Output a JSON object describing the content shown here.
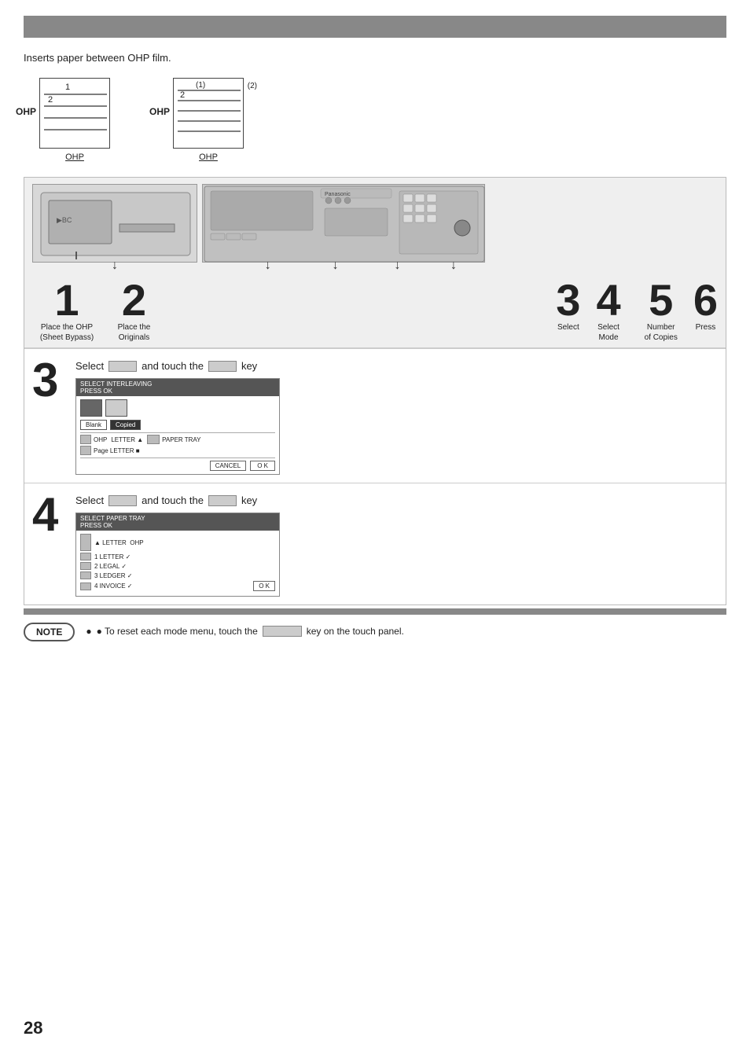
{
  "page": {
    "top_bar_bg": "#888888",
    "intro_text": "Inserts paper between OHP film.",
    "ohp_diagrams": {
      "box1": {
        "side_label": "OHP",
        "bottom_label": "OHP",
        "number1": "1",
        "number2": "2"
      },
      "box2": {
        "side_label": "OHP",
        "bottom_label": "OHP",
        "number1": "(1)",
        "number2": "2",
        "extra": "(2)"
      }
    },
    "step_numbers": [
      {
        "num": "1",
        "label": "Place the OHP\n(Sheet Bypass)"
      },
      {
        "num": "2",
        "label": "Place the\nOriginals"
      },
      {
        "num": "3",
        "label": "Select"
      },
      {
        "num": "4",
        "label": "Select\nMode"
      },
      {
        "num": "5",
        "label": "Number\nof Copies"
      },
      {
        "num": "6",
        "label": "Press"
      }
    ],
    "step3": {
      "big_num": "3",
      "title_prefix": "Select",
      "title_middle": "and touch the",
      "title_suffix": "key",
      "screen_header": "SELECT INTERLEAVING\nPRESS OK",
      "blank_btn": "Blank",
      "copied_btn": "Copied",
      "ohp_row": "OHP  LETTER  ▲  PAPER TRAY",
      "page_row": "Page  LETTER  ■",
      "cancel_btn": "CANCEL",
      "ok_btn": "O K"
    },
    "step4": {
      "big_num": "4",
      "title_prefix": "Select",
      "title_middle": "and touch the",
      "title_suffix": "key",
      "screen_header": "SELECT PAPER TRAY\nPRESS OK",
      "rows": [
        "▲ LETTER  OHP",
        "1 LETTER ✓",
        "2 LEGAL ✓",
        "3 LEDGER ✓",
        "4 INVOICE ✓"
      ],
      "ok_btn": "O K"
    },
    "note": {
      "badge": "NOTE",
      "text_before": "● To reset each mode menu, touch the",
      "text_after": "key on the touch panel."
    },
    "page_number": "28"
  }
}
